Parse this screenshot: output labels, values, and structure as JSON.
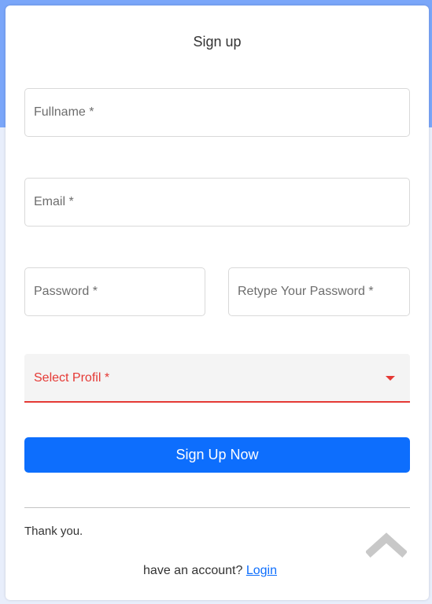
{
  "form": {
    "title": "Sign up",
    "fullname_placeholder": "Fullname *",
    "email_placeholder": "Email *",
    "password_placeholder": "Password *",
    "retype_placeholder": "Retype Your Password *",
    "select_label": "Select Profil *",
    "submit_label": "Sign Up Now"
  },
  "footer": {
    "thanks": "Thank you.",
    "account_prompt": "have an account?",
    "login_link": "Login"
  },
  "icons": {
    "select_caret": "caret-down-icon",
    "scroll_top": "chevron-up-icon"
  },
  "colors": {
    "accent": "#0d6efd",
    "error": "#e53935",
    "header_bg": "#7aa6f9"
  }
}
